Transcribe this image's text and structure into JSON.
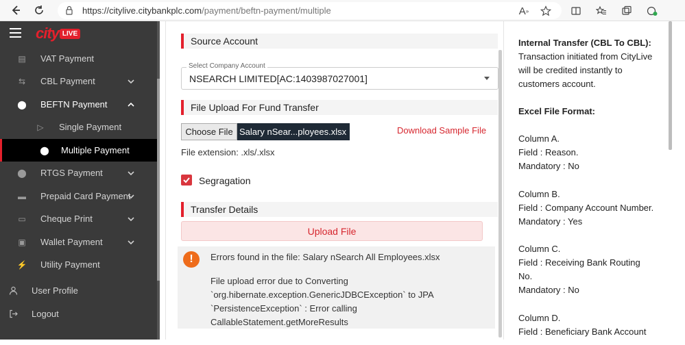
{
  "browser": {
    "url_domain": "https://citylive.citybankplc.com",
    "url_path": "/payment/beftn-payment/multiple"
  },
  "sidebar": {
    "logo_text": "city",
    "logo_badge": "LIVE",
    "items": [
      {
        "label": "VAT Payment",
        "icon": "receipt-icon"
      },
      {
        "label": "CBL Payment",
        "icon": "transfer-icon"
      },
      {
        "label": "BEFTN Payment",
        "icon": "circle-icon"
      },
      {
        "label": "Single Payment",
        "icon": "play-outline-icon"
      },
      {
        "label": "Multiple Payment",
        "icon": "circle-icon"
      },
      {
        "label": "RTGS Payment",
        "icon": "circle-icon"
      },
      {
        "label": "Prepaid Card Payment",
        "icon": "card-icon"
      },
      {
        "label": "Cheque Print",
        "icon": "cheque-icon"
      },
      {
        "label": "Wallet Payment",
        "icon": "wallet-icon"
      },
      {
        "label": "Utility Payment",
        "icon": "utility-icon"
      },
      {
        "label": "User Profile",
        "icon": "user-icon"
      },
      {
        "label": "Logout",
        "icon": "logout-icon"
      }
    ]
  },
  "main": {
    "source_account_heading": "Source Account",
    "select_label": "Select Company Account",
    "select_value": "NSEARCH LIMITED[AC:1403987027001]",
    "file_upload_heading": "File Upload For Fund Transfer",
    "choose_file_label": "Choose File",
    "file_name": "Salary nSear...ployees.xlsx",
    "download_sample": "Download Sample File",
    "file_extension": "File extension: .xls/.xlsx",
    "segregation_label": "Segragation",
    "transfer_details_heading": "Transfer Details",
    "upload_button": "Upload File",
    "error_title": "Errors found in the file: Salary nSearch All Employees.xlsx",
    "error_message": "File upload error due to Converting `org.hibernate.exception.GenericJDBCException` to JPA `PersistenceException` : Error calling CallableStatement.getMoreResults"
  },
  "info": {
    "title": "Internal Transfer (CBL To CBL):",
    "desc": "Transaction initiated from CityLive will be credited instantly to customers account.",
    "excel_heading": "Excel File Format:",
    "col_a": "Column A.",
    "col_a_field": "Field : Reason.",
    "col_a_mand": "Mandatory : No",
    "col_b": "Column B.",
    "col_b_field": "Field : Company Account Number.",
    "col_b_mand": "Mandatory : Yes",
    "col_c": "Column C.",
    "col_c_field": "Field : Receiving Bank Routing No.",
    "col_c_mand": "Mandatory : No",
    "col_d": "Column D.",
    "col_d_field": "Field : Beneficiary Bank Account"
  }
}
